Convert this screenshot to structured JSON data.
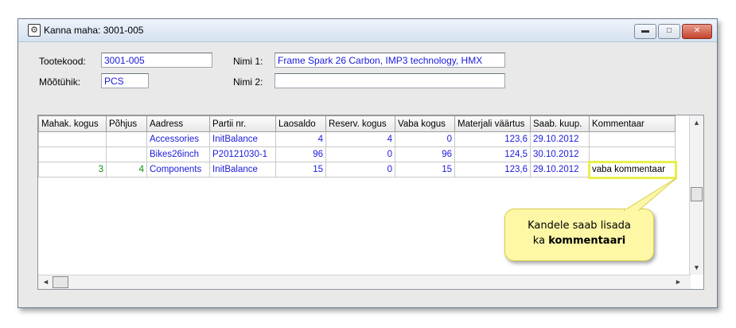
{
  "window": {
    "title": "Kanna maha: 3001-005",
    "controls": {
      "minimize": "▬",
      "maximize": "□",
      "close": "✕"
    }
  },
  "form": {
    "tootekood_label": "Tootekood:",
    "tootekood_value": "3001-005",
    "mootuhik_label": "Mõõtühik:",
    "mootuhik_value": "PCS",
    "nimi1_label": "Nimi 1:",
    "nimi1_value": "Frame Spark 26 Carbon, IMP3 technology, HMX",
    "nimi2_label": "Nimi 2:",
    "nimi2_value": ""
  },
  "grid": {
    "columns": [
      "Mahak. kogus",
      "Põhjus",
      "Aadress",
      "Partii nr.",
      "Laosaldo",
      "Reserv. kogus",
      "Vaba kogus",
      "Materjali väärtus",
      "Saab. kuup.",
      "Kommentaar"
    ],
    "rows": [
      [
        "",
        "",
        "Accessories",
        "InitBalance",
        "4",
        "4",
        "0",
        "123,6",
        "29.10.2012",
        ""
      ],
      [
        "",
        "",
        "Bikes26inch",
        "P20121030-1",
        "96",
        "0",
        "96",
        "124,5",
        "30.10.2012",
        ""
      ],
      [
        "3",
        "4",
        "Components",
        "InitBalance",
        "15",
        "0",
        "15",
        "123,6",
        "29.10.2012",
        "vaba kommentaar"
      ]
    ]
  },
  "callout": {
    "line1": "Kandele saab lisada",
    "line2_prefix": "ka ",
    "line2_bold": "kommentaari"
  },
  "colors": {
    "value_text": "#1a1adb",
    "entered_text": "#0a8f0a",
    "highlight": "#e8f04a",
    "callout_bg": "#fdf7a6"
  }
}
